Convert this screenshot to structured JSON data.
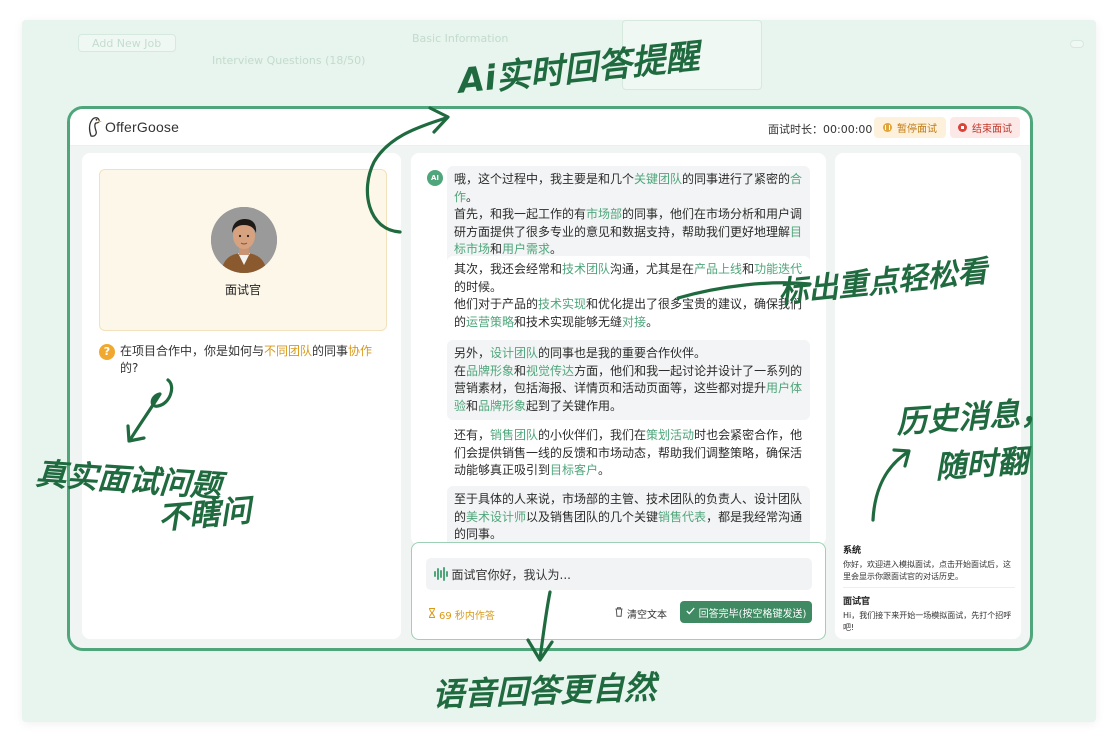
{
  "background_hints": {
    "item1": "Add New Job",
    "item2": "Interview Questions (18/50)",
    "item3": "Basic Information"
  },
  "app": {
    "logo_text": "OfferGoose",
    "timer_label": "面试时长：",
    "timer_value": "00:00:00",
    "pause_label": "暂停面试",
    "end_label": "结束面试"
  },
  "interviewer": {
    "label": "面试官"
  },
  "question": {
    "icon": "?",
    "parts": [
      {
        "text": "在项目合作中，你是如何与",
        "style": "normal"
      },
      {
        "text": "不同团队",
        "style": "orange"
      },
      {
        "text": "的同事",
        "style": "normal"
      },
      {
        "text": "协作",
        "style": "orange"
      },
      {
        "text": "的?",
        "style": "normal"
      }
    ]
  },
  "answer": {
    "ai_badge": "AI",
    "messages": [
      {
        "style": "bubble",
        "parts": [
          {
            "t": "哦，这个过程中，我主要是和几个"
          },
          {
            "t": "关键团队",
            "hl": true
          },
          {
            "t": "的同事进行了紧密的"
          },
          {
            "t": "合作",
            "hl": true
          },
          {
            "t": "。"
          },
          {
            "br": true
          },
          {
            "t": "首先，和我一起工作的有"
          },
          {
            "t": "市场部",
            "hl": true
          },
          {
            "t": "的同事，他们在市场分析和用户调研方面提供了很多专业的意见和数据支持，帮助我们更好地理解"
          },
          {
            "t": "目标市场",
            "hl": true
          },
          {
            "t": "和"
          },
          {
            "t": "用户需求",
            "hl": true
          },
          {
            "t": "。"
          }
        ]
      },
      {
        "style": "plain",
        "parts": [
          {
            "t": "其次，我还会经常和"
          },
          {
            "t": "技术团队",
            "hl": true
          },
          {
            "t": "沟通，尤其是在"
          },
          {
            "t": "产品上线",
            "hl": true
          },
          {
            "t": "和"
          },
          {
            "t": "功能迭代",
            "hl": true
          },
          {
            "t": "的时候。"
          },
          {
            "br": true
          },
          {
            "t": "他们对于产品的"
          },
          {
            "t": "技术实现",
            "hl": true
          },
          {
            "t": "和优化提出了很多宝贵的建议，确保我们的"
          },
          {
            "t": "运营策略",
            "hl": true
          },
          {
            "t": "和技术实现能够无缝"
          },
          {
            "t": "对接",
            "hl": true
          },
          {
            "t": "。"
          }
        ]
      },
      {
        "style": "bubble",
        "parts": [
          {
            "t": "另外，"
          },
          {
            "t": "设计团队",
            "hl": true
          },
          {
            "t": "的同事也是我的重要合作伙伴。"
          },
          {
            "br": true
          },
          {
            "t": "在"
          },
          {
            "t": "品牌形象",
            "hl": true
          },
          {
            "t": "和"
          },
          {
            "t": "视觉传达",
            "hl": true
          },
          {
            "t": "方面，他们和我一起讨论并设计了一系列的营销素材，包括海报、详情页和活动页面等，这些都对提升"
          },
          {
            "t": "用户体验",
            "hl": true
          },
          {
            "t": "和"
          },
          {
            "t": "品牌形象",
            "hl": true
          },
          {
            "t": "起到了关键作用。"
          }
        ]
      },
      {
        "style": "plain",
        "parts": [
          {
            "t": "还有，"
          },
          {
            "t": "销售团队",
            "hl": true
          },
          {
            "t": "的小伙伴们，我们在"
          },
          {
            "t": "策划活动",
            "hl": true
          },
          {
            "t": "时也会紧密合作，他们会提供销售一线的反馈和市场动态，帮助我们调整策略，确保活动能够真正吸引到"
          },
          {
            "t": "目标客户",
            "hl": true
          },
          {
            "t": "。"
          }
        ]
      },
      {
        "style": "bubble",
        "parts": [
          {
            "t": "至于具体的人来说，市场部的主管、技术团队的负责人、设计团队的"
          },
          {
            "t": "美术设计师",
            "hl": true
          },
          {
            "t": "以及销售团队的几个关键"
          },
          {
            "t": "销售代表",
            "hl": true
          },
          {
            "t": "，都是我经常沟通的同事。"
          }
        ]
      }
    ]
  },
  "input": {
    "value": "面试官你好，我认为...",
    "countdown": "69 秒内作答",
    "clear_label": "清空文本",
    "submit_label": "回答完毕(按空格键发送)"
  },
  "history": [
    {
      "title": "系统",
      "text": "你好，欢迎进入模拟面试，点击开始面试后，这里会显示你跟面试官的对话历史。"
    },
    {
      "title": "面试官",
      "text": "Hi，我们接下来开始一场模拟面试，先打个招呼吧!"
    }
  ],
  "annotations": {
    "top": "Ai实时回答提醒",
    "middle": "标出重点轻松看",
    "left_1": "真实面试问题",
    "left_2": "不瞎问",
    "right_1": "历史消息，",
    "right_2": "随时翻",
    "bottom": "语音回答更自然"
  },
  "colors": {
    "accent_green": "#4fa67b",
    "dark_green": "#3f8a63",
    "highlight_orange": "#d99a18",
    "annotation_ink": "#1f6a3f"
  }
}
